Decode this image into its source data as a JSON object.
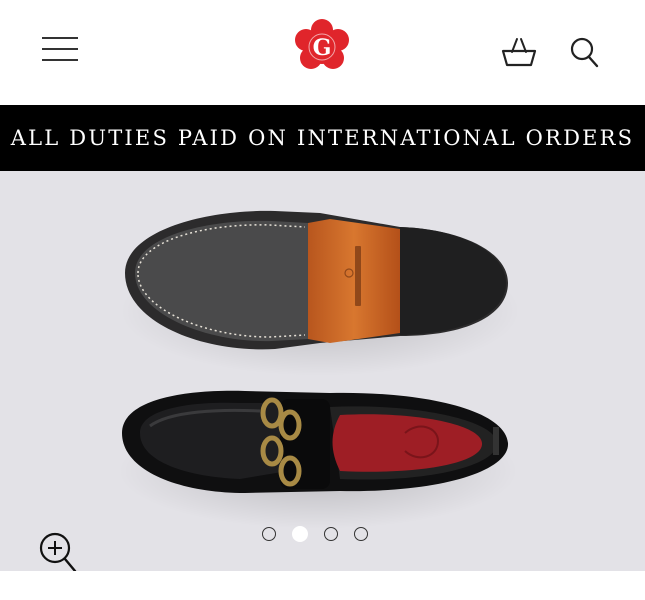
{
  "header": {
    "logo_letter": "G",
    "icons": {
      "menu": "hamburger-menu-icon",
      "basket": "basket-icon",
      "search": "search-icon"
    }
  },
  "banner": {
    "text": "ALL DUTIES PAID ON INTERNATIONAL ORDERS"
  },
  "gallery": {
    "slide_count": 4,
    "active_slide": 2,
    "zoom_icon": "zoom-in-icon"
  },
  "colors": {
    "brand_red": "#e0252b",
    "banner_bg": "#000000",
    "gallery_bg": "#e3e2e7"
  }
}
